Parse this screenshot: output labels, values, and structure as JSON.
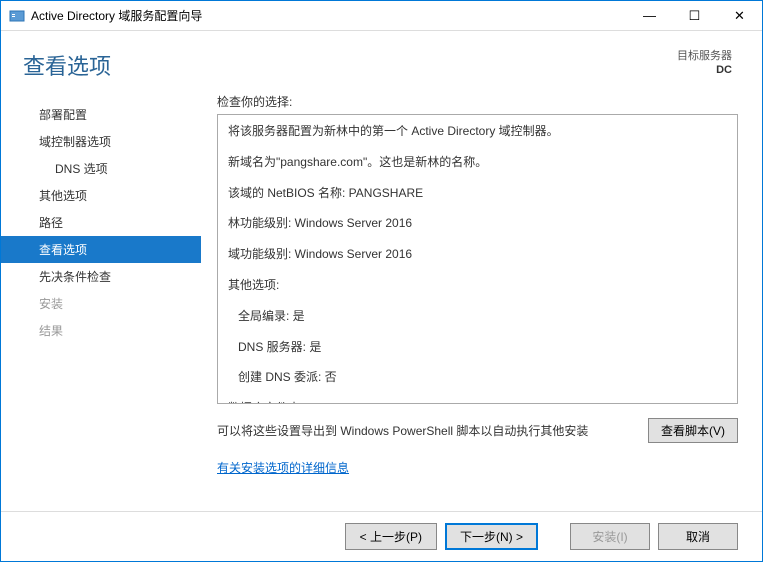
{
  "window": {
    "title": "Active Directory 域服务配置向导"
  },
  "header": {
    "title": "查看选项",
    "target_label": "目标服务器",
    "target_name": "DC"
  },
  "sidebar": {
    "items": [
      {
        "label": "部署配置",
        "state": "enabled"
      },
      {
        "label": "域控制器选项",
        "state": "enabled"
      },
      {
        "label": "DNS 选项",
        "state": "enabled",
        "sub": true
      },
      {
        "label": "其他选项",
        "state": "enabled"
      },
      {
        "label": "路径",
        "state": "enabled"
      },
      {
        "label": "查看选项",
        "state": "active"
      },
      {
        "label": "先决条件检查",
        "state": "enabled"
      },
      {
        "label": "安装",
        "state": "disabled"
      },
      {
        "label": "结果",
        "state": "disabled"
      }
    ]
  },
  "content": {
    "review_label": "检查你的选择:",
    "lines": [
      {
        "text": "将该服务器配置为新林中的第一个 Active Directory 域控制器。"
      },
      {
        "text": "新域名为\"pangshare.com\"。这也是新林的名称。"
      },
      {
        "text": "该域的 NetBIOS 名称: PANGSHARE"
      },
      {
        "text": "林功能级别: Windows Server 2016"
      },
      {
        "text": "域功能级别: Windows Server 2016"
      },
      {
        "text": "其他选项:"
      },
      {
        "text": "全局编录: 是",
        "sub": true
      },
      {
        "text": "DNS 服务器: 是",
        "sub": true
      },
      {
        "text": "创建 DNS 委派: 否",
        "sub": true
      },
      {
        "text": "数据库文件夹: C:\\Windows\\NTDS"
      }
    ],
    "export_text": "可以将这些设置导出到 Windows PowerShell 脚本以自动执行其他安装",
    "view_script": "查看脚本(V)",
    "more_link": "有关安装选项的详细信息"
  },
  "footer": {
    "prev": "< 上一步(P)",
    "next": "下一步(N) >",
    "install": "安装(I)",
    "cancel": "取消"
  }
}
